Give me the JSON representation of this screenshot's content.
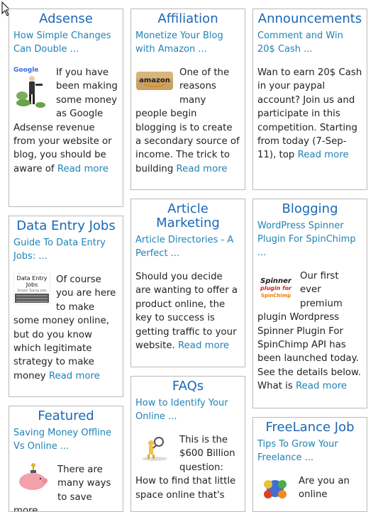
{
  "cards": [
    {
      "title": "Adsense",
      "link": "How Simple Changes Can Double ...",
      "body": "If you have been making some money as Google Adsense revenue from your website or blog, you should be aware of",
      "more": "Read more",
      "image": "google-adsense-icon"
    },
    {
      "title": "Affiliation",
      "link": "Monetize Your Blog with Amazon ...",
      "body": "One of the reasons many people begin blogging is to create a secondary source of income. The trick to building",
      "more": "Read more",
      "image": "amazon-icon"
    },
    {
      "title": "Announcements",
      "link": "Comment and Win 20$ Cash ...",
      "body": "Wan to earn 20$ Cash in your paypal account? Join us and participate in this competition. Starting from today (7-Sep-11), top",
      "more": "Read more",
      "image": ""
    },
    {
      "title": "Data Entry Jobs",
      "link": "Guide To Data Entry Jobs: ...",
      "body": "Of course you are here to make some money online, but do you know which legitimate strategy to make money",
      "more": "Read more",
      "image": "data-entry-jobs-icon"
    },
    {
      "title": "Article Marketing",
      "link": "Article Directories - A Perfect ...",
      "body": "Should you decide are wanting to offer a product online, the key to success is getting traffic to your website.",
      "more": "Read more",
      "image": ""
    },
    {
      "title": "Blogging",
      "link": "WordPress Spinner Plugin For SpinChimp ...",
      "body": "Our first ever premium plugin Wordpress Spinner Plugin For SpinChimp API has been launched today. See the details below. What is",
      "more": "Read more",
      "image": "spinner-plugin-icon"
    },
    {
      "title": "Featured",
      "link": "Saving Money Offline Vs Online ...",
      "body": "There are many ways to save more",
      "more": "",
      "image": "piggy-bank-icon"
    },
    {
      "title": "FAQs",
      "link": "How to Identify Your Online ...",
      "body": "This is the $600 Billion question: How to find that little space online that's",
      "more": "",
      "image": "question-figure-icon"
    },
    {
      "title": "FreeLance Job",
      "link": "Tips To Grow Your Freelance ...",
      "body": "Are you an online",
      "more": "",
      "image": "puzzle-people-icon"
    }
  ],
  "image_texts": {
    "google": "Google",
    "amazon": "amazon",
    "data_entry_1": "Data Entry",
    "data_entry_2": "Jobs",
    "data_entry_3": "Simple Typing Jobs",
    "spinner_1": "Spinner",
    "spinner_2": "plugin for",
    "spinner_3": "SpinChimp"
  }
}
